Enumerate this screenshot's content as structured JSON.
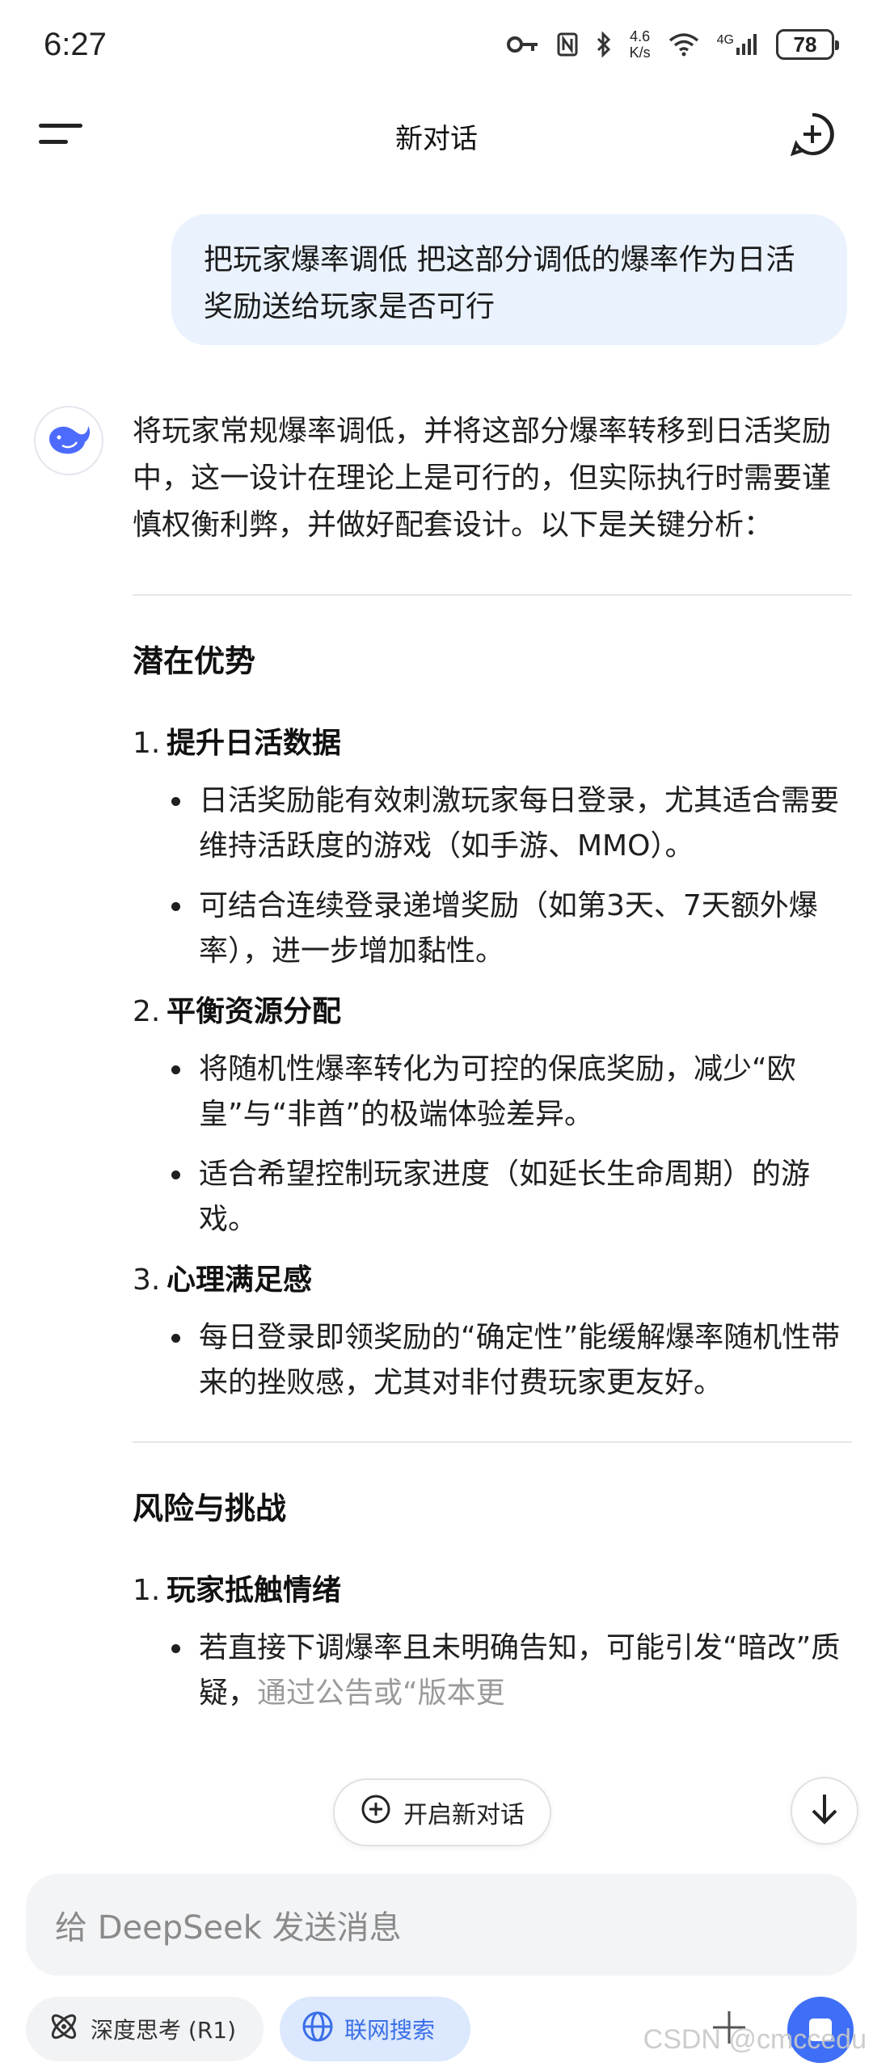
{
  "status_bar": {
    "time": "6:27",
    "net_speed_value": "4.6",
    "net_speed_unit": "K/s",
    "network_type": "4G",
    "battery": "78"
  },
  "header": {
    "title": "新对话"
  },
  "chat": {
    "user_message": "把玩家爆率调低 把这部分调低的爆率作为日活奖励送给玩家是否可行",
    "assistant": {
      "intro": "将玩家常规爆率调低，并将这部分爆率转移到日活奖励中，这一设计在理论上是可行的，但实际执行时需要谨慎权衡利弊，并做好配套设计。以下是关键分析：",
      "sections": [
        {
          "title": "潜在优势",
          "items": [
            {
              "number": "1.",
              "title": "提升日活数据",
              "bullets": [
                "日活奖励能有效刺激玩家每日登录，尤其适合需要维持活跃度的游戏（如手游、MMO）。",
                "可结合连续登录递增奖励（如第3天、7天额外爆率），进一步增加黏性。"
              ]
            },
            {
              "number": "2.",
              "title": "平衡资源分配",
              "bullets": [
                "将随机性爆率转化为可控的保底奖励，减少“欧皇”与“非酋”的极端体验差异。",
                "适合希望控制玩家进度（如延长生命周期）的游戏。"
              ]
            },
            {
              "number": "3.",
              "title": "心理满足感",
              "bullets": [
                "每日登录即领奖励的“确定性”能缓解爆率随机性带来的挫败感，尤其对非付费玩家更友好。"
              ]
            }
          ]
        },
        {
          "title": "风险与挑战",
          "items": [
            {
              "number": "1.",
              "title": "玩家抵触情绪",
              "bullets": [
                "若直接下调爆率且未明确告知，可能引发“暗改”质疑，",
                "通过公告或“版本更"
              ]
            }
          ]
        }
      ]
    }
  },
  "floating": {
    "new_chat_label": "开启新对话"
  },
  "composer": {
    "placeholder": "给 DeepSeek 发送消息",
    "deep_think_label": "深度思考 (R1)",
    "web_search_label": "联网搜索"
  },
  "watermark": "CSDN @cmccedu",
  "colors": {
    "accent": "#3f6ff6",
    "user_bubble": "#eaf2fe",
    "search_chip_bg": "#dbe8fd",
    "search_chip_text": "#3a6ee8"
  }
}
